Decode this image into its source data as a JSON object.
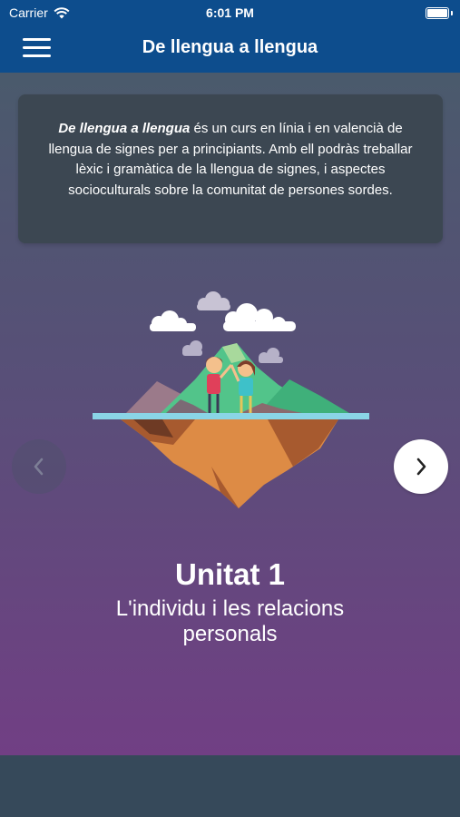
{
  "status_bar": {
    "carrier": "Carrier",
    "time": "6:01 PM"
  },
  "nav": {
    "title": "De llengua a llengua"
  },
  "intro": {
    "course_name": "De llengua a llengua",
    "text": " és un curs en línia i en valencià de llengua de signes per a principiants. Amb ell podràs treballar lèxic i gramàtica de la llengua de signes, i aspectes socioculturals sobre la comunitat de persones sordes."
  },
  "unit": {
    "title": "Unitat 1",
    "subtitle": "L'individu i les relacions personals"
  },
  "icons": {
    "menu": "hamburger-icon",
    "prev": "chevron-left-icon",
    "next": "chevron-right-icon",
    "wifi": "wifi-icon",
    "battery": "battery-icon"
  },
  "colors": {
    "nav_background": "#0d4d8d",
    "gradient_top": "#4a5a6c",
    "gradient_bottom": "#713f84",
    "card_background": "#3c4752"
  }
}
